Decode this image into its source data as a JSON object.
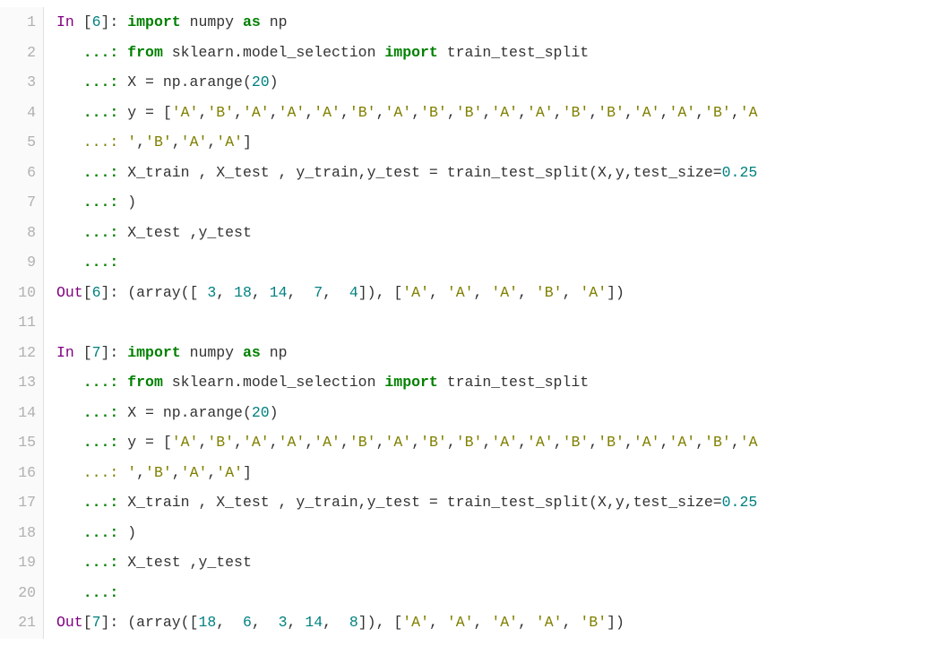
{
  "gutter": {
    "start": 1,
    "end": 21
  },
  "code": {
    "lines": [
      [
        {
          "t": "In ",
          "c": "kw"
        },
        {
          "t": "[",
          "c": ""
        },
        {
          "t": "6",
          "c": "num"
        },
        {
          "t": "]: ",
          "c": ""
        },
        {
          "t": "import",
          "c": "kw2"
        },
        {
          "t": " numpy ",
          "c": ""
        },
        {
          "t": "as",
          "c": "kw2"
        },
        {
          "t": " np",
          "c": ""
        }
      ],
      [
        {
          "t": "   ",
          "c": ""
        },
        {
          "t": "...:",
          "c": "cont"
        },
        {
          "t": " ",
          "c": ""
        },
        {
          "t": "from",
          "c": "kw2"
        },
        {
          "t": " sklearn.model_selection ",
          "c": ""
        },
        {
          "t": "import",
          "c": "kw2"
        },
        {
          "t": " train_test_split",
          "c": ""
        }
      ],
      [
        {
          "t": "   ",
          "c": ""
        },
        {
          "t": "...:",
          "c": "cont"
        },
        {
          "t": " X = np.arange(",
          "c": ""
        },
        {
          "t": "20",
          "c": "num"
        },
        {
          "t": ")",
          "c": ""
        }
      ],
      [
        {
          "t": "   ",
          "c": ""
        },
        {
          "t": "...:",
          "c": "cont"
        },
        {
          "t": " y = [",
          "c": ""
        },
        {
          "t": "'A'",
          "c": "str"
        },
        {
          "t": ",",
          "c": ""
        },
        {
          "t": "'B'",
          "c": "str"
        },
        {
          "t": ",",
          "c": ""
        },
        {
          "t": "'A'",
          "c": "str"
        },
        {
          "t": ",",
          "c": ""
        },
        {
          "t": "'A'",
          "c": "str"
        },
        {
          "t": ",",
          "c": ""
        },
        {
          "t": "'A'",
          "c": "str"
        },
        {
          "t": ",",
          "c": ""
        },
        {
          "t": "'B'",
          "c": "str"
        },
        {
          "t": ",",
          "c": ""
        },
        {
          "t": "'A'",
          "c": "str"
        },
        {
          "t": ",",
          "c": ""
        },
        {
          "t": "'B'",
          "c": "str"
        },
        {
          "t": ",",
          "c": ""
        },
        {
          "t": "'B'",
          "c": "str"
        },
        {
          "t": ",",
          "c": ""
        },
        {
          "t": "'A'",
          "c": "str"
        },
        {
          "t": ",",
          "c": ""
        },
        {
          "t": "'A'",
          "c": "str"
        },
        {
          "t": ",",
          "c": ""
        },
        {
          "t": "'B'",
          "c": "str"
        },
        {
          "t": ",",
          "c": ""
        },
        {
          "t": "'B'",
          "c": "str"
        },
        {
          "t": ",",
          "c": ""
        },
        {
          "t": "'A'",
          "c": "str"
        },
        {
          "t": ",",
          "c": ""
        },
        {
          "t": "'A'",
          "c": "str"
        },
        {
          "t": ",",
          "c": ""
        },
        {
          "t": "'B'",
          "c": "str"
        },
        {
          "t": ",",
          "c": ""
        },
        {
          "t": "'A",
          "c": "str"
        }
      ],
      [
        {
          "t": "   ",
          "c": ""
        },
        {
          "t": "...:",
          "c": "contolive"
        },
        {
          "t": " ",
          "c": ""
        },
        {
          "t": "'",
          "c": "str"
        },
        {
          "t": ",",
          "c": ""
        },
        {
          "t": "'B'",
          "c": "str"
        },
        {
          "t": ",",
          "c": ""
        },
        {
          "t": "'A'",
          "c": "str"
        },
        {
          "t": ",",
          "c": ""
        },
        {
          "t": "'A'",
          "c": "str"
        },
        {
          "t": "]",
          "c": ""
        }
      ],
      [
        {
          "t": "   ",
          "c": ""
        },
        {
          "t": "...:",
          "c": "cont"
        },
        {
          "t": " X_train , X_test , y_train,y_test = train_test_split(X,y,test_size=",
          "c": ""
        },
        {
          "t": "0.25",
          "c": "num"
        }
      ],
      [
        {
          "t": "   ",
          "c": ""
        },
        {
          "t": "...:",
          "c": "cont"
        },
        {
          "t": " )",
          "c": ""
        }
      ],
      [
        {
          "t": "   ",
          "c": ""
        },
        {
          "t": "...:",
          "c": "cont"
        },
        {
          "t": " X_test ,y_test",
          "c": ""
        }
      ],
      [
        {
          "t": "   ",
          "c": ""
        },
        {
          "t": "...:",
          "c": "cont"
        }
      ],
      [
        {
          "t": "Out",
          "c": "kw"
        },
        {
          "t": "[",
          "c": ""
        },
        {
          "t": "6",
          "c": "num"
        },
        {
          "t": "]: (array([ ",
          "c": ""
        },
        {
          "t": "3",
          "c": "num"
        },
        {
          "t": ", ",
          "c": ""
        },
        {
          "t": "18",
          "c": "num"
        },
        {
          "t": ", ",
          "c": ""
        },
        {
          "t": "14",
          "c": "num"
        },
        {
          "t": ",  ",
          "c": ""
        },
        {
          "t": "7",
          "c": "num"
        },
        {
          "t": ",  ",
          "c": ""
        },
        {
          "t": "4",
          "c": "num"
        },
        {
          "t": "]), [",
          "c": ""
        },
        {
          "t": "'A'",
          "c": "str"
        },
        {
          "t": ", ",
          "c": ""
        },
        {
          "t": "'A'",
          "c": "str"
        },
        {
          "t": ", ",
          "c": ""
        },
        {
          "t": "'A'",
          "c": "str"
        },
        {
          "t": ", ",
          "c": ""
        },
        {
          "t": "'B'",
          "c": "str"
        },
        {
          "t": ", ",
          "c": ""
        },
        {
          "t": "'A'",
          "c": "str"
        },
        {
          "t": "])",
          "c": ""
        }
      ],
      [
        {
          "t": " ",
          "c": ""
        }
      ],
      [
        {
          "t": "In ",
          "c": "kw"
        },
        {
          "t": "[",
          "c": ""
        },
        {
          "t": "7",
          "c": "num"
        },
        {
          "t": "]: ",
          "c": ""
        },
        {
          "t": "import",
          "c": "kw2"
        },
        {
          "t": " numpy ",
          "c": ""
        },
        {
          "t": "as",
          "c": "kw2"
        },
        {
          "t": " np",
          "c": ""
        }
      ],
      [
        {
          "t": "   ",
          "c": ""
        },
        {
          "t": "...:",
          "c": "cont"
        },
        {
          "t": " ",
          "c": ""
        },
        {
          "t": "from",
          "c": "kw2"
        },
        {
          "t": " sklearn.model_selection ",
          "c": ""
        },
        {
          "t": "import",
          "c": "kw2"
        },
        {
          "t": " train_test_split",
          "c": ""
        }
      ],
      [
        {
          "t": "   ",
          "c": ""
        },
        {
          "t": "...:",
          "c": "cont"
        },
        {
          "t": " X = np.arange(",
          "c": ""
        },
        {
          "t": "20",
          "c": "num"
        },
        {
          "t": ")",
          "c": ""
        }
      ],
      [
        {
          "t": "   ",
          "c": ""
        },
        {
          "t": "...:",
          "c": "cont"
        },
        {
          "t": " y = [",
          "c": ""
        },
        {
          "t": "'A'",
          "c": "str"
        },
        {
          "t": ",",
          "c": ""
        },
        {
          "t": "'B'",
          "c": "str"
        },
        {
          "t": ",",
          "c": ""
        },
        {
          "t": "'A'",
          "c": "str"
        },
        {
          "t": ",",
          "c": ""
        },
        {
          "t": "'A'",
          "c": "str"
        },
        {
          "t": ",",
          "c": ""
        },
        {
          "t": "'A'",
          "c": "str"
        },
        {
          "t": ",",
          "c": ""
        },
        {
          "t": "'B'",
          "c": "str"
        },
        {
          "t": ",",
          "c": ""
        },
        {
          "t": "'A'",
          "c": "str"
        },
        {
          "t": ",",
          "c": ""
        },
        {
          "t": "'B'",
          "c": "str"
        },
        {
          "t": ",",
          "c": ""
        },
        {
          "t": "'B'",
          "c": "str"
        },
        {
          "t": ",",
          "c": ""
        },
        {
          "t": "'A'",
          "c": "str"
        },
        {
          "t": ",",
          "c": ""
        },
        {
          "t": "'A'",
          "c": "str"
        },
        {
          "t": ",",
          "c": ""
        },
        {
          "t": "'B'",
          "c": "str"
        },
        {
          "t": ",",
          "c": ""
        },
        {
          "t": "'B'",
          "c": "str"
        },
        {
          "t": ",",
          "c": ""
        },
        {
          "t": "'A'",
          "c": "str"
        },
        {
          "t": ",",
          "c": ""
        },
        {
          "t": "'A'",
          "c": "str"
        },
        {
          "t": ",",
          "c": ""
        },
        {
          "t": "'B'",
          "c": "str"
        },
        {
          "t": ",",
          "c": ""
        },
        {
          "t": "'A",
          "c": "str"
        }
      ],
      [
        {
          "t": "   ",
          "c": ""
        },
        {
          "t": "...:",
          "c": "contolive"
        },
        {
          "t": " ",
          "c": ""
        },
        {
          "t": "'",
          "c": "str"
        },
        {
          "t": ",",
          "c": ""
        },
        {
          "t": "'B'",
          "c": "str"
        },
        {
          "t": ",",
          "c": ""
        },
        {
          "t": "'A'",
          "c": "str"
        },
        {
          "t": ",",
          "c": ""
        },
        {
          "t": "'A'",
          "c": "str"
        },
        {
          "t": "]",
          "c": ""
        }
      ],
      [
        {
          "t": "   ",
          "c": ""
        },
        {
          "t": "...:",
          "c": "cont"
        },
        {
          "t": " X_train , X_test , y_train,y_test = train_test_split(X,y,test_size=",
          "c": ""
        },
        {
          "t": "0.25",
          "c": "num"
        }
      ],
      [
        {
          "t": "   ",
          "c": ""
        },
        {
          "t": "...:",
          "c": "cont"
        },
        {
          "t": " )",
          "c": ""
        }
      ],
      [
        {
          "t": "   ",
          "c": ""
        },
        {
          "t": "...:",
          "c": "cont"
        },
        {
          "t": " X_test ,y_test",
          "c": ""
        }
      ],
      [
        {
          "t": "   ",
          "c": ""
        },
        {
          "t": "...:",
          "c": "cont"
        }
      ],
      [
        {
          "t": "Out",
          "c": "kw"
        },
        {
          "t": "[",
          "c": ""
        },
        {
          "t": "7",
          "c": "num"
        },
        {
          "t": "]: (array([",
          "c": ""
        },
        {
          "t": "18",
          "c": "num"
        },
        {
          "t": ",  ",
          "c": ""
        },
        {
          "t": "6",
          "c": "num"
        },
        {
          "t": ",  ",
          "c": ""
        },
        {
          "t": "3",
          "c": "num"
        },
        {
          "t": ", ",
          "c": ""
        },
        {
          "t": "14",
          "c": "num"
        },
        {
          "t": ",  ",
          "c": ""
        },
        {
          "t": "8",
          "c": "num"
        },
        {
          "t": "]), [",
          "c": ""
        },
        {
          "t": "'A'",
          "c": "str"
        },
        {
          "t": ", ",
          "c": ""
        },
        {
          "t": "'A'",
          "c": "str"
        },
        {
          "t": ", ",
          "c": ""
        },
        {
          "t": "'A'",
          "c": "str"
        },
        {
          "t": ", ",
          "c": ""
        },
        {
          "t": "'A'",
          "c": "str"
        },
        {
          "t": ", ",
          "c": ""
        },
        {
          "t": "'B'",
          "c": "str"
        },
        {
          "t": "])",
          "c": ""
        }
      ]
    ]
  }
}
